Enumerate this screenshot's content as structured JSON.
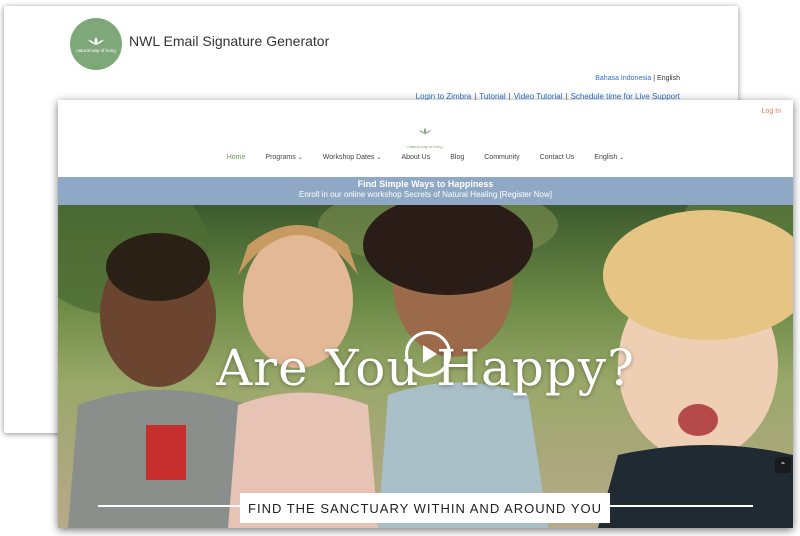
{
  "back_window": {
    "title": "NWL Email Signature Generator",
    "logo_text": "natural way of living",
    "language": {
      "option_1": "Bahasa Indonesia",
      "separator": "|",
      "option_2": "English"
    },
    "links": [
      {
        "label": "Login to Zimbra"
      },
      {
        "label": "Tutorial"
      },
      {
        "label": "Video Tutorial"
      },
      {
        "label": "Schedule time for Live Support"
      }
    ],
    "link_separator": "|"
  },
  "front_window": {
    "login_label": "Log In",
    "logo_text": "natural way of living",
    "nav": [
      {
        "label": "Home",
        "active": true
      },
      {
        "label": "Programs",
        "dropdown": true
      },
      {
        "label": "Workshop Dates",
        "dropdown": true
      },
      {
        "label": "About Us"
      },
      {
        "label": "Blog"
      },
      {
        "label": "Community"
      },
      {
        "label": "Contact Us"
      },
      {
        "label": "English",
        "dropdown": true
      }
    ],
    "banner": {
      "title": "Find Simple Ways to Happiness",
      "subtitle": "Enroll in our online workshop Secrets of Natural Healing [Register Now]"
    },
    "hero": {
      "title": "Are You Happy?",
      "tagline": "FIND THE SANCTUARY WITHIN AND AROUND YOU"
    }
  },
  "colors": {
    "accent_green": "#7fa87a",
    "link_blue": "#2f6fd1",
    "banner_blue": "#8fa8c5",
    "login_orange": "#e07a5f"
  },
  "icons": [
    "lotus-icon",
    "play-icon",
    "chevron-down-icon",
    "chevron-up-icon"
  ]
}
